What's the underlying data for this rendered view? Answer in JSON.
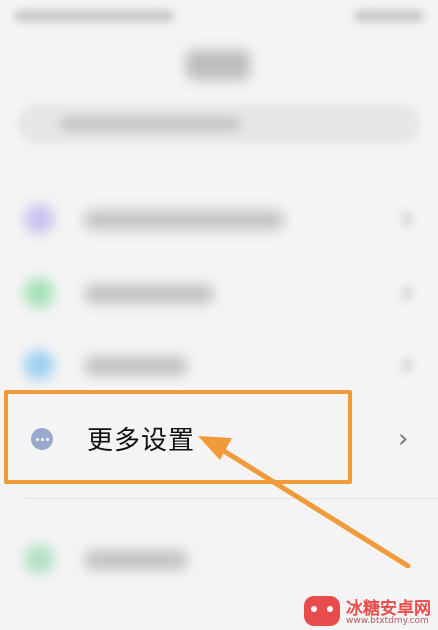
{
  "more_settings": {
    "label": "更多设置",
    "chevron": "›"
  },
  "icons": {
    "more_settings_icon": "more-dots-icon",
    "chevron_icon": "chevron-right-icon"
  },
  "colors": {
    "highlight": "#f09a3a",
    "more_settings_icon": "#9aa8cc",
    "watermark_brand": "#e94c4c"
  },
  "watermark": {
    "title": "冰糖安卓网",
    "url": "www.btxtdmy.com"
  }
}
